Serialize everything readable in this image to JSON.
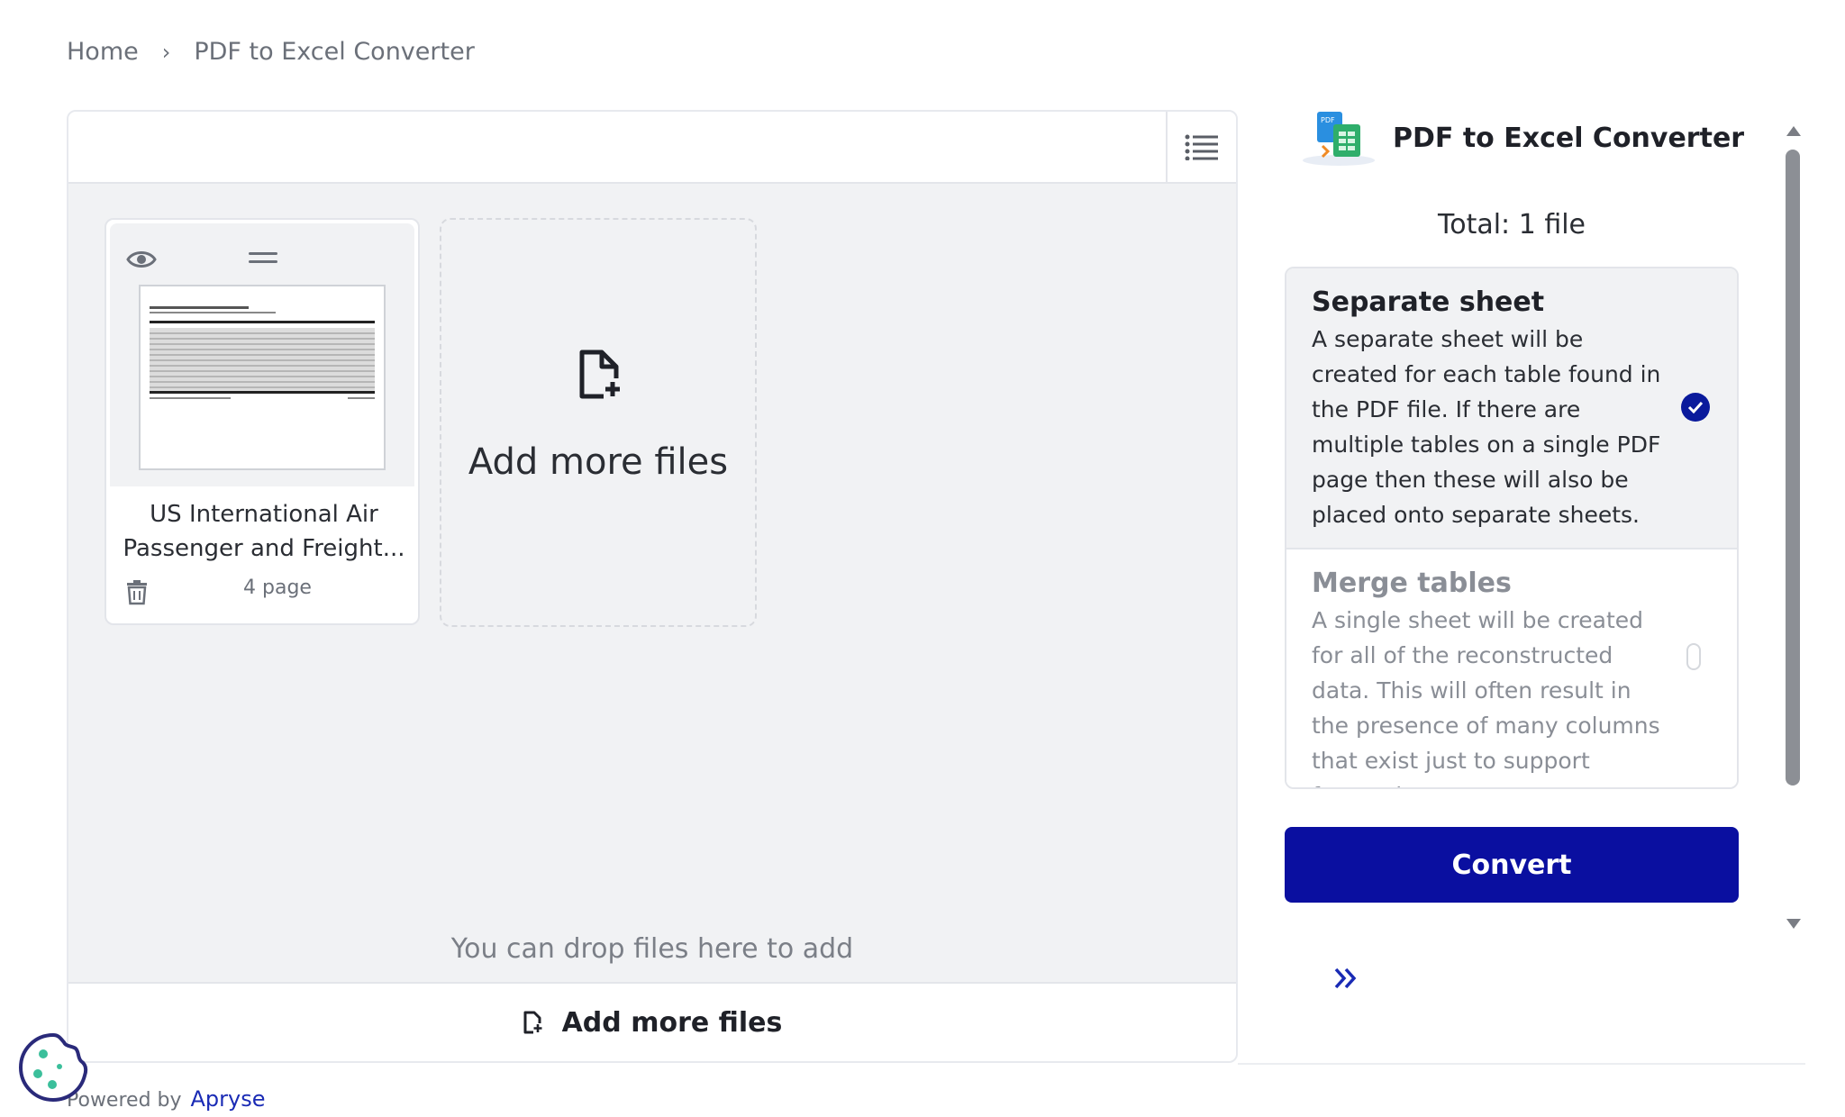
{
  "breadcrumb": {
    "home": "Home",
    "separator": "›",
    "current": "PDF to Excel Converter"
  },
  "file": {
    "name_line1": "US International Air",
    "name_line2": "Passenger and Freight...",
    "pages": "4 page"
  },
  "add_card": {
    "label": "Add more files"
  },
  "drop_hint": "You can drop files here to add",
  "bottom_bar": {
    "label": "Add more files"
  },
  "sidebar": {
    "app_title": "PDF to Excel Converter",
    "total": "Total: 1 file",
    "options": [
      {
        "title": "Separate sheet",
        "description": "A separate sheet will be created for each table found in the PDF file. If there are multiple tables on a single PDF page then these will also be placed onto separate sheets.",
        "selected": true
      },
      {
        "title": "Merge tables",
        "description": "A single sheet will be created for all of the reconstructed data. This will often result in the presence of many columns that exist just to support formatting.",
        "selected": false
      }
    ],
    "convert_label": "Convert"
  },
  "footer": {
    "powered_by": "Powered by",
    "brand": "Apryse"
  },
  "colors": {
    "accent": "#0a0fa0",
    "check": "#0a1a9c",
    "link": "#1a2bb5",
    "cookie": "#2a2a7a",
    "cookie_dots": "#3bbf9b"
  }
}
